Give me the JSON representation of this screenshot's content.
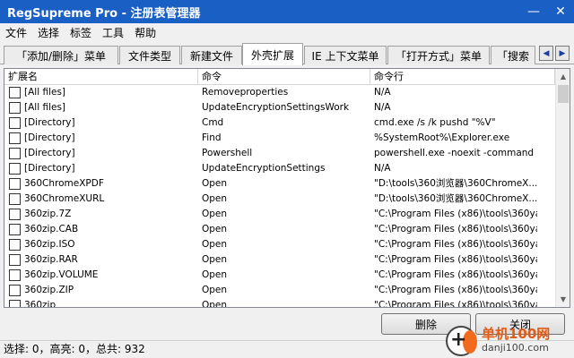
{
  "window": {
    "title": "RegSupreme Pro - 注册表管理器",
    "minimize_glyph": "—",
    "close_glyph": "✕"
  },
  "menu": [
    "文件",
    "选择",
    "标签",
    "工具",
    "帮助"
  ],
  "tabs": [
    {
      "label": "「添加/删除」菜单",
      "active": false
    },
    {
      "label": "文件类型",
      "active": false
    },
    {
      "label": "新建文件",
      "active": false
    },
    {
      "label": "外壳扩展",
      "active": true
    },
    {
      "label": "IE 上下文菜单",
      "active": false
    },
    {
      "label": "「打开方式」菜单",
      "active": false
    },
    {
      "label": "「搜索",
      "active": false
    }
  ],
  "tab_scroll": {
    "left_glyph": "◀",
    "right_glyph": "▶"
  },
  "table": {
    "columns": [
      "扩展名",
      "命令",
      "命令行"
    ],
    "rows": [
      {
        "ext": "[All files]",
        "command": "Removeproperties",
        "cmdline": "N/A"
      },
      {
        "ext": "[All files]",
        "command": "UpdateEncryptionSettingsWork",
        "cmdline": "N/A"
      },
      {
        "ext": "[Directory]",
        "command": "Cmd",
        "cmdline": "cmd.exe /s /k pushd \"%V\""
      },
      {
        "ext": "[Directory]",
        "command": "Find",
        "cmdline": "%SystemRoot%\\Explorer.exe"
      },
      {
        "ext": "[Directory]",
        "command": "Powershell",
        "cmdline": "powershell.exe -noexit -command S..."
      },
      {
        "ext": "[Directory]",
        "command": "UpdateEncryptionSettings",
        "cmdline": "N/A"
      },
      {
        "ext": "360ChromeXPDF",
        "command": "Open",
        "cmdline": "\"D:\\tools\\360浏览器\\360ChromeX..."
      },
      {
        "ext": "360ChromeXURL",
        "command": "Open",
        "cmdline": "\"D:\\tools\\360浏览器\\360ChromeX..."
      },
      {
        "ext": "360zip.7Z",
        "command": "Open",
        "cmdline": "\"C:\\Program Files (x86)\\tools\\360ya..."
      },
      {
        "ext": "360zip.CAB",
        "command": "Open",
        "cmdline": "\"C:\\Program Files (x86)\\tools\\360ya..."
      },
      {
        "ext": "360zip.ISO",
        "command": "Open",
        "cmdline": "\"C:\\Program Files (x86)\\tools\\360ya..."
      },
      {
        "ext": "360zip.RAR",
        "command": "Open",
        "cmdline": "\"C:\\Program Files (x86)\\tools\\360ya..."
      },
      {
        "ext": "360zip.VOLUME",
        "command": "Open",
        "cmdline": "\"C:\\Program Files (x86)\\tools\\360ya..."
      },
      {
        "ext": "360zip.ZIP",
        "command": "Open",
        "cmdline": "\"C:\\Program Files (x86)\\tools\\360ya..."
      },
      {
        "ext": "360zip",
        "command": "Open",
        "cmdline": "\"C:\\Program Files (x86)\\tools\\360ya..."
      }
    ]
  },
  "scrollbar": {
    "up_glyph": "▲",
    "down_glyph": "▼"
  },
  "buttons": {
    "delete": "删除",
    "close": "关闭"
  },
  "status": "选择: 0，高亮: 0，总共: 932",
  "watermark": {
    "site_cn": "单机100网",
    "site_url": "danji100.com"
  },
  "colors": {
    "titlebar": "#1a5fc4",
    "watermark_accent": "#f26b1d"
  }
}
